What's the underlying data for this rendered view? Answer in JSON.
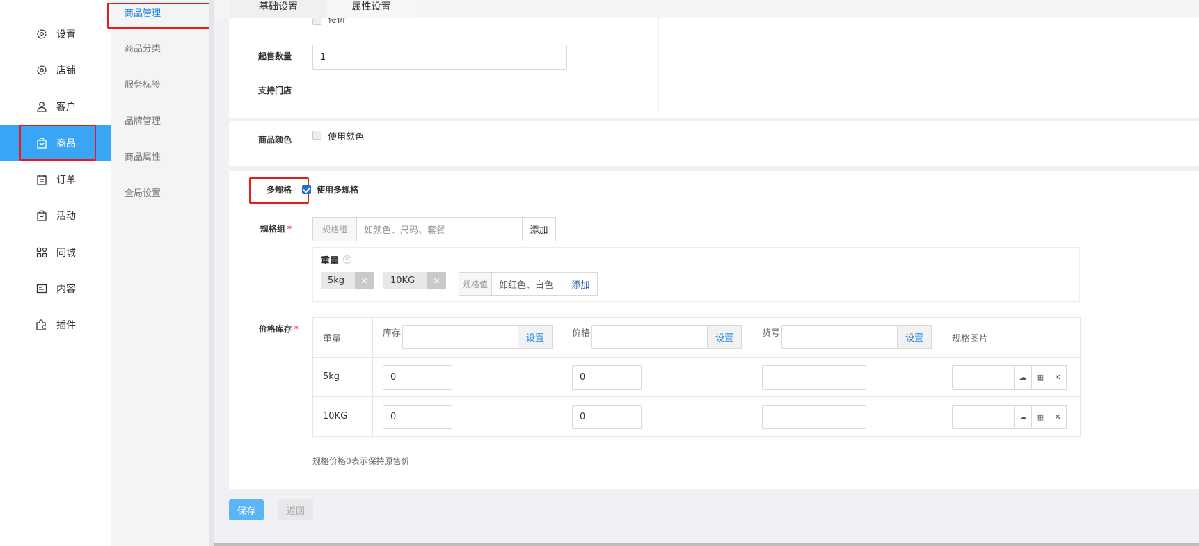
{
  "nav": {
    "items": [
      {
        "label": "设置",
        "icon": "gear-icon"
      },
      {
        "label": "店铺",
        "icon": "gear-icon"
      },
      {
        "label": "客户",
        "icon": "user-icon"
      },
      {
        "label": "商品",
        "icon": "shopping-bag-icon"
      },
      {
        "label": "订单",
        "icon": "calendar-icon"
      },
      {
        "label": "活动",
        "icon": "shopping-bag-icon"
      },
      {
        "label": "同城",
        "icon": "grid-icon"
      },
      {
        "label": "内容",
        "icon": "document-icon"
      },
      {
        "label": "插件",
        "icon": "puzzle-icon"
      }
    ],
    "active": "商品"
  },
  "subnav": {
    "items": [
      "商品管理",
      "商品分类",
      "服务标签",
      "品牌管理",
      "商品属性",
      "全局设置"
    ],
    "active": "商品管理"
  },
  "tabs": {
    "base": "基础设置",
    "attr": "属性设置"
  },
  "form": {
    "partial_checkbox_label": "待价",
    "min_qty_label": "起售数量",
    "min_qty_value": "1",
    "store_label": "支持门店",
    "color_label": "商品颜色",
    "color_checkbox": "使用颜色",
    "multi_spec_label": "多规格",
    "multi_spec_checkbox": "使用多规格",
    "spec_group_label": "规格组",
    "spec_group_addon": "规格组",
    "spec_group_placeholder": "如颜色、尺码、套餐",
    "spec_group_add": "添加",
    "spec_group_name": "重量",
    "spec_values": [
      "5kg",
      "10KG"
    ],
    "spec_value_addon": "规格值",
    "spec_value_placeholder": "如红色、白色",
    "spec_value_add": "添加",
    "price_stock_label": "价格库存",
    "note": "规格价格0表示保持原售价"
  },
  "table": {
    "headers": {
      "weight": "重量",
      "stock": "库存",
      "price": "价格",
      "sku": "货号",
      "image": "规格图片",
      "set": "设置"
    },
    "rows": [
      {
        "weight": "5kg",
        "stock": "0",
        "price": "0",
        "sku": ""
      },
      {
        "weight": "10KG",
        "stock": "0",
        "price": "0",
        "sku": ""
      }
    ]
  },
  "buttons": {
    "save": "保存",
    "back": "返回"
  },
  "colors": {
    "accent": "#3aa4f5",
    "link": "#1e88e5",
    "highlight": "#e81b1b"
  }
}
